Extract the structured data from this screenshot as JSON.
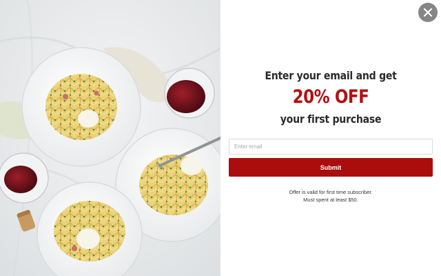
{
  "popup": {
    "headline_top": "Enter your email and get",
    "headline_offer": "20% OFF",
    "headline_bottom": "your first purchase",
    "email_placeholder": "Enter email",
    "email_value": "",
    "submit_label": "Submit",
    "fine_print_line_1": "Offer is valid for first time subscriber.",
    "fine_print_line_2": "Must spent at least $50."
  },
  "icons": {
    "close": "close-icon",
    "image": "pasta-dishes-photo"
  },
  "colors": {
    "accent": "#ab0d0d",
    "offer_text": "#b30f11",
    "heading_text": "#2b2b2b",
    "close_button_bg": "#858585",
    "input_border": "#d9d9d9"
  }
}
